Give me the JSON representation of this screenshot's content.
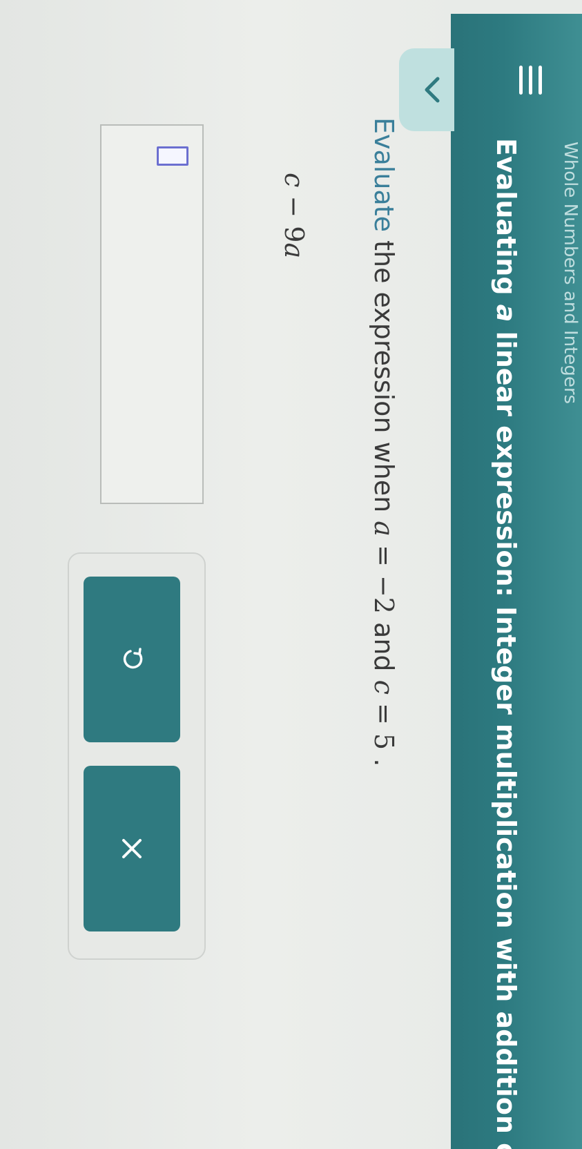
{
  "header": {
    "topic": "Whole Numbers and Integers",
    "title_prefix": "Evaluating ",
    "title_article": "a",
    "title_rest": " linear expression: Integer multiplication with addition or...",
    "menu_icon": "hamburger-menu-icon",
    "back_icon": "chevron-down-icon"
  },
  "question": {
    "prompt_word": "Evaluate",
    "prompt_mid": " the expression when ",
    "var_a": "a",
    "eq1": " = ",
    "val_a": "−2",
    "and": " and ",
    "var_c": "c",
    "eq2": " = ",
    "val_c": "5",
    "period": " .",
    "expression_var1": "c",
    "expression_op": " − 9",
    "expression_var2": "a"
  },
  "answer": {
    "value": ""
  },
  "buttons": {
    "undo_icon": "undo-icon",
    "clear_icon": "close-icon"
  },
  "colors": {
    "header_teal": "#2d7a80",
    "button_teal": "#2f7a80",
    "accent": "#3a7f9a",
    "answer_slot": "#6b6fd0"
  }
}
